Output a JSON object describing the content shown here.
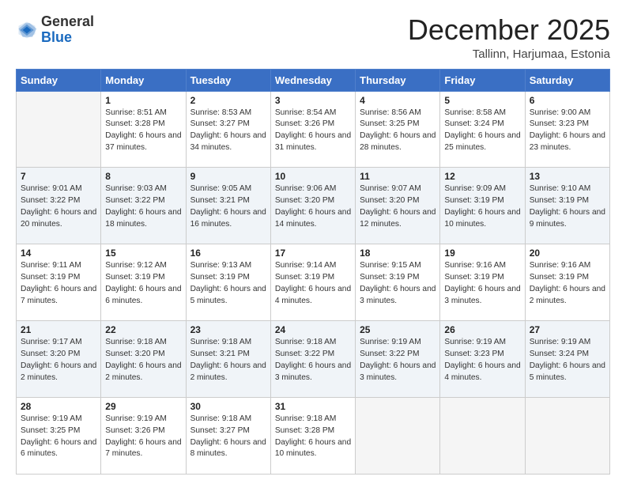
{
  "logo": {
    "general": "General",
    "blue": "Blue"
  },
  "header": {
    "month": "December 2025",
    "location": "Tallinn, Harjumaa, Estonia"
  },
  "weekdays": [
    "Sunday",
    "Monday",
    "Tuesday",
    "Wednesday",
    "Thursday",
    "Friday",
    "Saturday"
  ],
  "weeks": [
    [
      {
        "day": "",
        "sunrise": "",
        "sunset": "",
        "daylight": ""
      },
      {
        "day": "1",
        "sunrise": "Sunrise: 8:51 AM",
        "sunset": "Sunset: 3:28 PM",
        "daylight": "Daylight: 6 hours and 37 minutes."
      },
      {
        "day": "2",
        "sunrise": "Sunrise: 8:53 AM",
        "sunset": "Sunset: 3:27 PM",
        "daylight": "Daylight: 6 hours and 34 minutes."
      },
      {
        "day": "3",
        "sunrise": "Sunrise: 8:54 AM",
        "sunset": "Sunset: 3:26 PM",
        "daylight": "Daylight: 6 hours and 31 minutes."
      },
      {
        "day": "4",
        "sunrise": "Sunrise: 8:56 AM",
        "sunset": "Sunset: 3:25 PM",
        "daylight": "Daylight: 6 hours and 28 minutes."
      },
      {
        "day": "5",
        "sunrise": "Sunrise: 8:58 AM",
        "sunset": "Sunset: 3:24 PM",
        "daylight": "Daylight: 6 hours and 25 minutes."
      },
      {
        "day": "6",
        "sunrise": "Sunrise: 9:00 AM",
        "sunset": "Sunset: 3:23 PM",
        "daylight": "Daylight: 6 hours and 23 minutes."
      }
    ],
    [
      {
        "day": "7",
        "sunrise": "Sunrise: 9:01 AM",
        "sunset": "Sunset: 3:22 PM",
        "daylight": "Daylight: 6 hours and 20 minutes."
      },
      {
        "day": "8",
        "sunrise": "Sunrise: 9:03 AM",
        "sunset": "Sunset: 3:22 PM",
        "daylight": "Daylight: 6 hours and 18 minutes."
      },
      {
        "day": "9",
        "sunrise": "Sunrise: 9:05 AM",
        "sunset": "Sunset: 3:21 PM",
        "daylight": "Daylight: 6 hours and 16 minutes."
      },
      {
        "day": "10",
        "sunrise": "Sunrise: 9:06 AM",
        "sunset": "Sunset: 3:20 PM",
        "daylight": "Daylight: 6 hours and 14 minutes."
      },
      {
        "day": "11",
        "sunrise": "Sunrise: 9:07 AM",
        "sunset": "Sunset: 3:20 PM",
        "daylight": "Daylight: 6 hours and 12 minutes."
      },
      {
        "day": "12",
        "sunrise": "Sunrise: 9:09 AM",
        "sunset": "Sunset: 3:19 PM",
        "daylight": "Daylight: 6 hours and 10 minutes."
      },
      {
        "day": "13",
        "sunrise": "Sunrise: 9:10 AM",
        "sunset": "Sunset: 3:19 PM",
        "daylight": "Daylight: 6 hours and 9 minutes."
      }
    ],
    [
      {
        "day": "14",
        "sunrise": "Sunrise: 9:11 AM",
        "sunset": "Sunset: 3:19 PM",
        "daylight": "Daylight: 6 hours and 7 minutes."
      },
      {
        "day": "15",
        "sunrise": "Sunrise: 9:12 AM",
        "sunset": "Sunset: 3:19 PM",
        "daylight": "Daylight: 6 hours and 6 minutes."
      },
      {
        "day": "16",
        "sunrise": "Sunrise: 9:13 AM",
        "sunset": "Sunset: 3:19 PM",
        "daylight": "Daylight: 6 hours and 5 minutes."
      },
      {
        "day": "17",
        "sunrise": "Sunrise: 9:14 AM",
        "sunset": "Sunset: 3:19 PM",
        "daylight": "Daylight: 6 hours and 4 minutes."
      },
      {
        "day": "18",
        "sunrise": "Sunrise: 9:15 AM",
        "sunset": "Sunset: 3:19 PM",
        "daylight": "Daylight: 6 hours and 3 minutes."
      },
      {
        "day": "19",
        "sunrise": "Sunrise: 9:16 AM",
        "sunset": "Sunset: 3:19 PM",
        "daylight": "Daylight: 6 hours and 3 minutes."
      },
      {
        "day": "20",
        "sunrise": "Sunrise: 9:16 AM",
        "sunset": "Sunset: 3:19 PM",
        "daylight": "Daylight: 6 hours and 2 minutes."
      }
    ],
    [
      {
        "day": "21",
        "sunrise": "Sunrise: 9:17 AM",
        "sunset": "Sunset: 3:20 PM",
        "daylight": "Daylight: 6 hours and 2 minutes."
      },
      {
        "day": "22",
        "sunrise": "Sunrise: 9:18 AM",
        "sunset": "Sunset: 3:20 PM",
        "daylight": "Daylight: 6 hours and 2 minutes."
      },
      {
        "day": "23",
        "sunrise": "Sunrise: 9:18 AM",
        "sunset": "Sunset: 3:21 PM",
        "daylight": "Daylight: 6 hours and 2 minutes."
      },
      {
        "day": "24",
        "sunrise": "Sunrise: 9:18 AM",
        "sunset": "Sunset: 3:22 PM",
        "daylight": "Daylight: 6 hours and 3 minutes."
      },
      {
        "day": "25",
        "sunrise": "Sunrise: 9:19 AM",
        "sunset": "Sunset: 3:22 PM",
        "daylight": "Daylight: 6 hours and 3 minutes."
      },
      {
        "day": "26",
        "sunrise": "Sunrise: 9:19 AM",
        "sunset": "Sunset: 3:23 PM",
        "daylight": "Daylight: 6 hours and 4 minutes."
      },
      {
        "day": "27",
        "sunrise": "Sunrise: 9:19 AM",
        "sunset": "Sunset: 3:24 PM",
        "daylight": "Daylight: 6 hours and 5 minutes."
      }
    ],
    [
      {
        "day": "28",
        "sunrise": "Sunrise: 9:19 AM",
        "sunset": "Sunset: 3:25 PM",
        "daylight": "Daylight: 6 hours and 6 minutes."
      },
      {
        "day": "29",
        "sunrise": "Sunrise: 9:19 AM",
        "sunset": "Sunset: 3:26 PM",
        "daylight": "Daylight: 6 hours and 7 minutes."
      },
      {
        "day": "30",
        "sunrise": "Sunrise: 9:18 AM",
        "sunset": "Sunset: 3:27 PM",
        "daylight": "Daylight: 6 hours and 8 minutes."
      },
      {
        "day": "31",
        "sunrise": "Sunrise: 9:18 AM",
        "sunset": "Sunset: 3:28 PM",
        "daylight": "Daylight: 6 hours and 10 minutes."
      },
      {
        "day": "",
        "sunrise": "",
        "sunset": "",
        "daylight": ""
      },
      {
        "day": "",
        "sunrise": "",
        "sunset": "",
        "daylight": ""
      },
      {
        "day": "",
        "sunrise": "",
        "sunset": "",
        "daylight": ""
      }
    ]
  ]
}
